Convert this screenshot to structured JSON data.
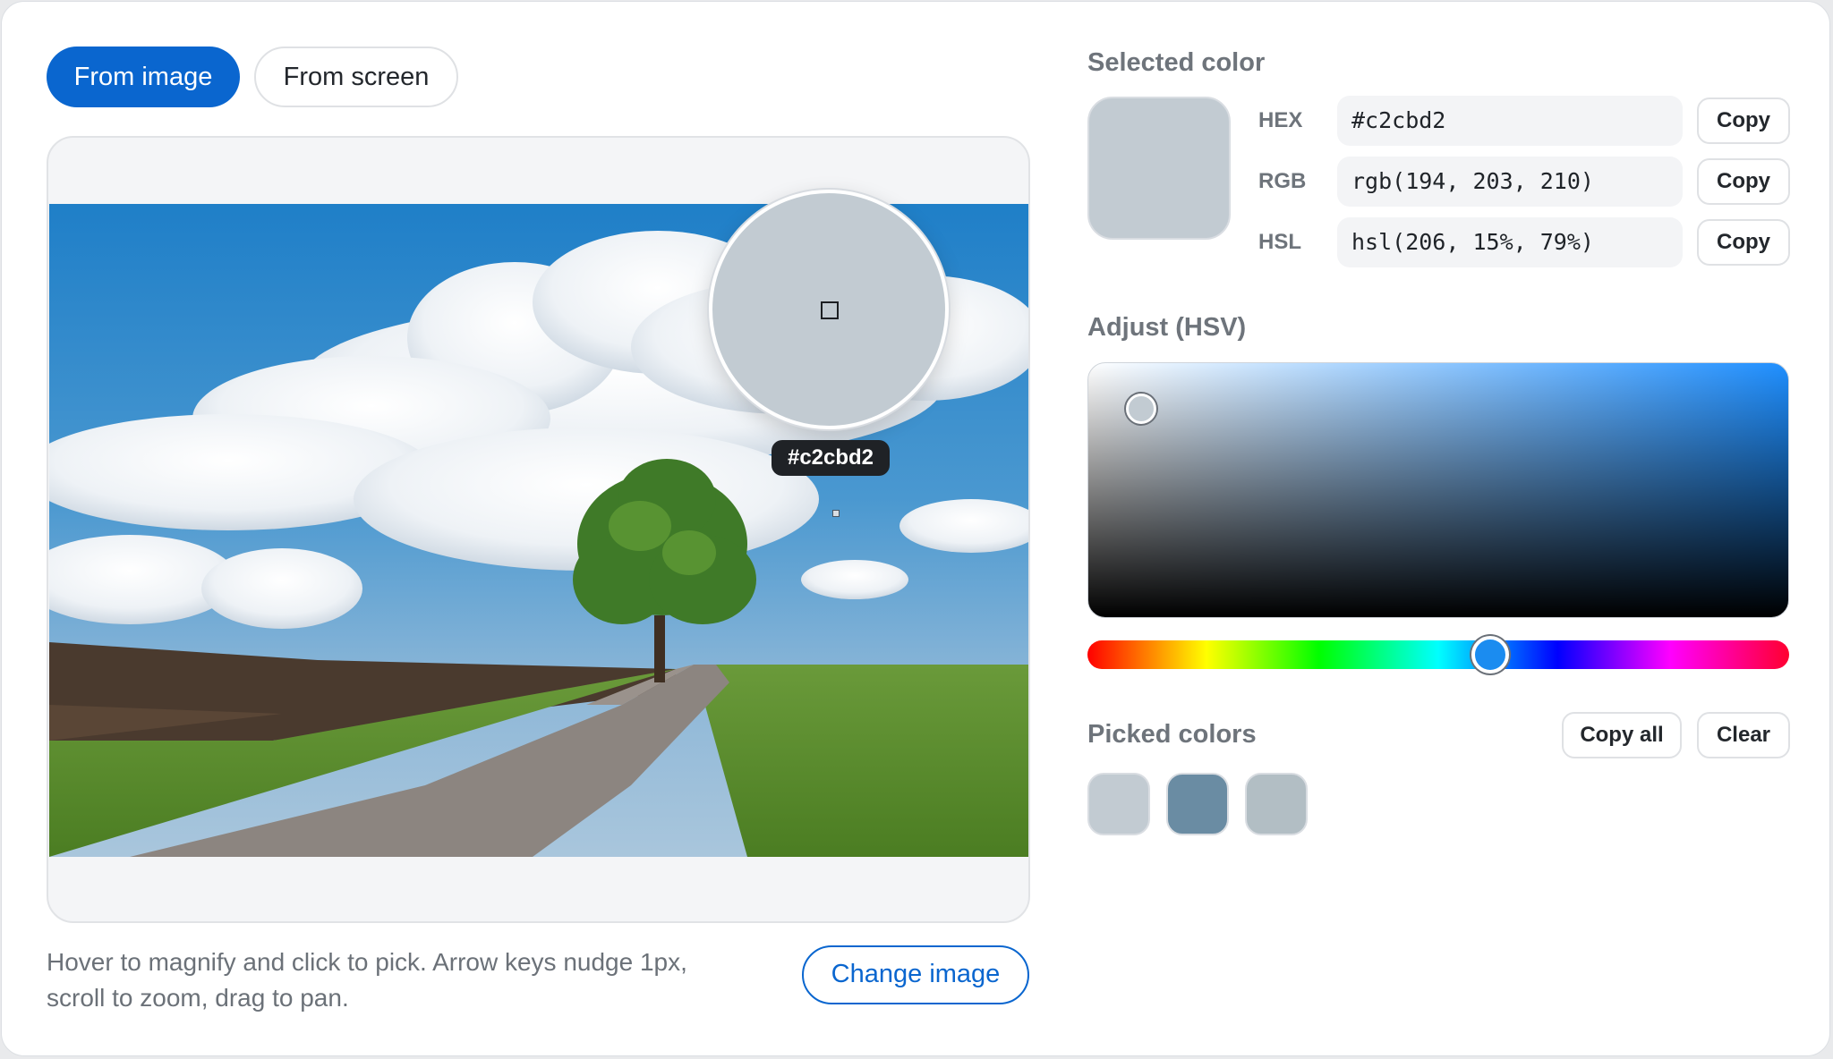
{
  "mode": {
    "from_image": "From image",
    "from_screen": "From screen"
  },
  "magnifier": {
    "hex": "#c2cbd2"
  },
  "hint": {
    "line1": "Hover to magnify and click to pick. Arrow keys nudge 1px,",
    "line2": "scroll to zoom, drag to pan."
  },
  "change_image": "Change image",
  "selected": {
    "title": "Selected color",
    "color": "#c2cbd2",
    "rows": [
      {
        "label": "HEX",
        "value": "#c2cbd2",
        "copy": "Copy"
      },
      {
        "label": "RGB",
        "value": "rgb(194, 203, 210)",
        "copy": "Copy"
      },
      {
        "label": "HSL",
        "value": "hsl(206, 15%, 79%)",
        "copy": "Copy"
      }
    ]
  },
  "adjust": {
    "title": "Adjust (HSV)",
    "hue": 206,
    "saturation": 0.08,
    "value": 0.86
  },
  "picked": {
    "title": "Picked colors",
    "copy_all": "Copy all",
    "clear": "Clear",
    "colors": [
      "#c2cbd2",
      "#6a8ca3",
      "#b2bec4"
    ]
  },
  "colors": {
    "accent": "#0a66cf"
  }
}
